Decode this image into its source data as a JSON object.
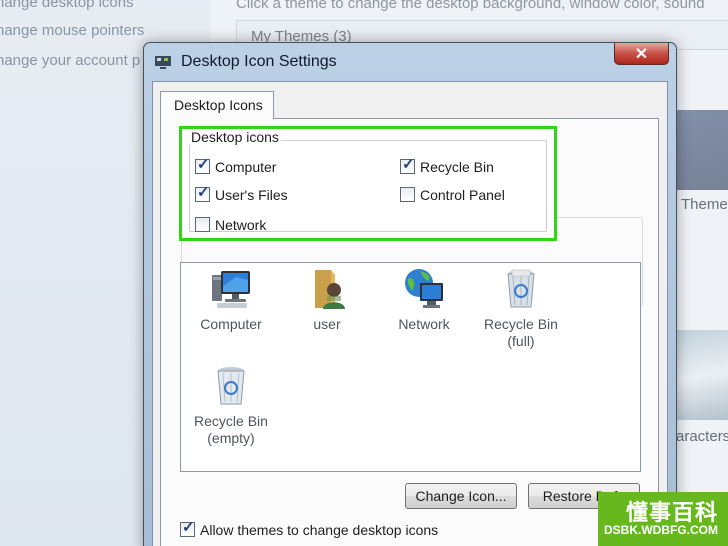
{
  "background": {
    "sidebar_links": [
      "hange desktop icons",
      "hange mouse pointers",
      "hange your account p"
    ],
    "heading": "Click a theme to change the desktop background, window color, sound",
    "themes_group": "My Themes (3)",
    "theme_label": "Theme",
    "characters_label": "aracters"
  },
  "dialog": {
    "title": "Desktop Icon Settings",
    "close_symbol": "✕",
    "tab": "Desktop Icons",
    "group_legend": "Desktop icons",
    "checkboxes": [
      {
        "label": "Computer",
        "checked": true
      },
      {
        "label": "Recycle Bin",
        "checked": true
      },
      {
        "label": "User's Files",
        "checked": true
      },
      {
        "label": "Control Panel",
        "checked": false
      },
      {
        "label": "Network",
        "checked": false
      }
    ],
    "icons": [
      {
        "label": "Computer",
        "icon": "computer-icon"
      },
      {
        "label": "user",
        "icon": "user-folder-icon"
      },
      {
        "label": "Network",
        "icon": "network-icon"
      },
      {
        "label": "Recycle Bin (full)",
        "line1": "Recycle Bin",
        "line2": "(full)",
        "icon": "recycle-bin-full-icon"
      },
      {
        "label": "Recycle Bin (empty)",
        "line1": "Recycle Bin",
        "line2": "(empty)",
        "icon": "recycle-bin-empty-icon"
      }
    ],
    "change_icon_button": "Change Icon...",
    "restore_default_button": "Restore Defa",
    "allow_themes": {
      "label": "Allow themes to change desktop icons",
      "checked": true
    }
  },
  "watermark": {
    "chinese": "懂事百科",
    "url": "DSBK.WDBFG.COM"
  },
  "colors": {
    "highlight": "#2fd516",
    "close_button": "#c75047",
    "watermark": "#67b81e"
  }
}
